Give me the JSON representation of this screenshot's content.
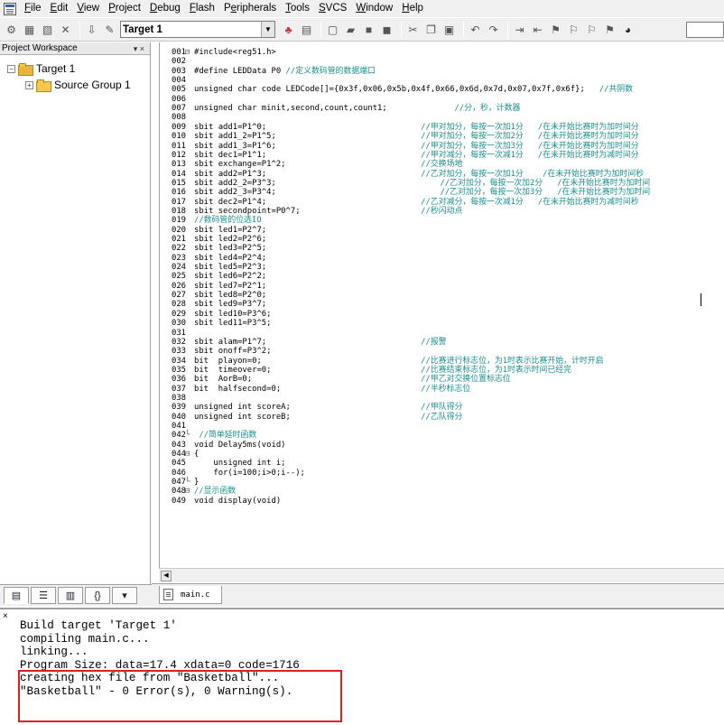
{
  "menu": {
    "items": [
      {
        "u": "F",
        "rest": "ile"
      },
      {
        "u": "E",
        "rest": "dit"
      },
      {
        "u": "V",
        "rest": "iew"
      },
      {
        "u": "P",
        "rest": "roject"
      },
      {
        "u": "D",
        "rest": "ebug",
        "pre": ""
      },
      {
        "u": "F",
        "rest": "lash",
        "pre": ""
      },
      {
        "u": "e",
        "rest": "ripherals",
        "pre": "P"
      },
      {
        "u": "T",
        "rest": "ools"
      },
      {
        "u": "S",
        "rest": "VCS"
      },
      {
        "u": "W",
        "rest": "indow"
      },
      {
        "u": "H",
        "rest": "elp"
      }
    ]
  },
  "toolbar": {
    "target": "Target 1"
  },
  "workspace": {
    "title": "Project Workspace",
    "controls": "▾ ×",
    "tree": [
      {
        "label": "Target 1",
        "expand": "−",
        "level": 0
      },
      {
        "label": "Source Group 1",
        "expand": "+",
        "level": 1
      }
    ]
  },
  "editor": {
    "file_tab": "main.c",
    "lines": [
      {
        "n": "001",
        "f": "⊟",
        "code": "#include<reg51.h>",
        "cm": ""
      },
      {
        "n": "002",
        "f": " ",
        "code": "",
        "cm": ""
      },
      {
        "n": "003",
        "f": " ",
        "code": "#define LEDData P0 ",
        "cm": "//定义数码管的数据端口"
      },
      {
        "n": "004",
        "f": " ",
        "code": "",
        "cm": ""
      },
      {
        "n": "005",
        "f": " ",
        "code": "unsigned char code LEDCode[]={0x3f,0x06,0x5b,0x4f,0x66,0x6d,0x7d,0x07,0x7f,0x6f};   ",
        "cm": "//共阴数"
      },
      {
        "n": "006",
        "f": " ",
        "code": "",
        "cm": ""
      },
      {
        "n": "007",
        "f": " ",
        "code": "unsigned char minit,second,count,count1;              ",
        "cm": "//分，秒，计数器"
      },
      {
        "n": "008",
        "f": " ",
        "code": "",
        "cm": ""
      },
      {
        "n": "009",
        "f": " ",
        "code": "sbit add1=P1^0;                                ",
        "cm": "//甲对加分，每按一次加1分   /在未开始比赛时为加时间分"
      },
      {
        "n": "010",
        "f": " ",
        "code": "sbit add1_2=P1^5;                              ",
        "cm": "//甲对加分，每按一次加2分   /在未开始比赛时为加时间分"
      },
      {
        "n": "011",
        "f": " ",
        "code": "sbit add1_3=P1^6;                              ",
        "cm": "//甲对加分，每按一次加3分   /在未开始比赛时为加时间分"
      },
      {
        "n": "012",
        "f": " ",
        "code": "sbit dec1=P1^1;                                ",
        "cm": "//甲对减分，每按一次减1分   /在未开始比赛时为减时间分"
      },
      {
        "n": "013",
        "f": " ",
        "code": "sbit exchange=P1^2;                            ",
        "cm": "//交换场地"
      },
      {
        "n": "014",
        "f": " ",
        "code": "sbit add2=P1^3;                                ",
        "cm": "//乙对加分，每按一次加1分    /在未开始比赛时为加时间秒"
      },
      {
        "n": "015",
        "f": " ",
        "code": "sbit add2_2=P3^3;                                  ",
        "cm": "//乙对加分，每按一次加2分   /在未开始比赛时为加时间"
      },
      {
        "n": "016",
        "f": " ",
        "code": "sbit add2_3=P3^4;                                  ",
        "cm": "//乙对加分，每按一次加3分   /在未开始比赛时为加时间"
      },
      {
        "n": "017",
        "f": " ",
        "code": "sbit dec2=P1^4;                                ",
        "cm": "//乙对减分，每按一次减1分   /在未开始比赛时为减时间秒"
      },
      {
        "n": "018",
        "f": " ",
        "code": "sbit secondpoint=P0^7;                         ",
        "cm": "//秒闪动点"
      },
      {
        "n": "019",
        "f": " ",
        "code": "",
        "cm": "//数码管的位选IO"
      },
      {
        "n": "020",
        "f": " ",
        "code": "sbit led1=P2^7;",
        "cm": ""
      },
      {
        "n": "021",
        "f": " ",
        "code": "sbit led2=P2^6;",
        "cm": ""
      },
      {
        "n": "022",
        "f": " ",
        "code": "sbit led3=P2^5;",
        "cm": ""
      },
      {
        "n": "023",
        "f": " ",
        "code": "sbit led4=P2^4;",
        "cm": ""
      },
      {
        "n": "024",
        "f": " ",
        "code": "sbit led5=P2^3;",
        "cm": ""
      },
      {
        "n": "025",
        "f": " ",
        "code": "sbit led6=P2^2;",
        "cm": ""
      },
      {
        "n": "026",
        "f": " ",
        "code": "sbit led7=P2^1;",
        "cm": ""
      },
      {
        "n": "027",
        "f": " ",
        "code": "sbit led8=P2^0;",
        "cm": ""
      },
      {
        "n": "028",
        "f": " ",
        "code": "sbit led9=P3^7;",
        "cm": ""
      },
      {
        "n": "029",
        "f": " ",
        "code": "sbit led10=P3^6;",
        "cm": ""
      },
      {
        "n": "030",
        "f": " ",
        "code": "sbit led11=P3^5;",
        "cm": ""
      },
      {
        "n": "031",
        "f": " ",
        "code": "",
        "cm": ""
      },
      {
        "n": "032",
        "f": " ",
        "code": "sbit alam=P1^7;                                ",
        "cm": "//报警"
      },
      {
        "n": "033",
        "f": " ",
        "code": "sbit onoff=P3^2;",
        "cm": ""
      },
      {
        "n": "034",
        "f": " ",
        "code": "bit  playon=0;                                 ",
        "cm": "//比赛进行标志位，为1时表示比赛开始，计时开启"
      },
      {
        "n": "035",
        "f": " ",
        "code": "bit  timeover=0;                               ",
        "cm": "//比赛结束标志位，为1时表示时间已经完"
      },
      {
        "n": "036",
        "f": " ",
        "code": "bit  AorB=0;                                   ",
        "cm": "//甲乙对交换位置标志位"
      },
      {
        "n": "037",
        "f": " ",
        "code": "bit  halfsecond=0;                             ",
        "cm": "//半秒标志位"
      },
      {
        "n": "038",
        "f": " ",
        "code": "",
        "cm": ""
      },
      {
        "n": "039",
        "f": " ",
        "code": "unsigned int scoreA;                           ",
        "cm": "//甲队得分"
      },
      {
        "n": "040",
        "f": " ",
        "code": "unsigned int scoreB;                           ",
        "cm": "//乙队得分"
      },
      {
        "n": "041",
        "f": " ",
        "code": "",
        "cm": ""
      },
      {
        "n": "042",
        "f": "└",
        "code": " ",
        "cm": "//简单延时函数"
      },
      {
        "n": "043",
        "f": " ",
        "code": "void Delay5ms(void)",
        "cm": ""
      },
      {
        "n": "044",
        "f": "⊟",
        "code": "{",
        "cm": ""
      },
      {
        "n": "045",
        "f": " ",
        "code": "    unsigned int i;",
        "cm": ""
      },
      {
        "n": "046",
        "f": " ",
        "code": "    for(i=100;i>0;i--);",
        "cm": ""
      },
      {
        "n": "047",
        "f": "└",
        "code": "}",
        "cm": ""
      },
      {
        "n": "048",
        "f": "⊟",
        "code": "",
        "cm": "//显示函数"
      },
      {
        "n": "049",
        "f": " ",
        "code": "void display(void)",
        "cm": ""
      }
    ]
  },
  "output": {
    "close": "×",
    "lines": [
      "Build target 'Target 1'",
      "compiling main.c...",
      "linking...",
      "Program Size: data=17.4 xdata=0 code=1716",
      "creating hex file from \"Basketball\"...",
      "\"Basketball\" - 0 Error(s), 0 Warning(s)."
    ]
  },
  "colors": {
    "comment": "#1a8f8f",
    "highlight": "#e01e1e"
  }
}
